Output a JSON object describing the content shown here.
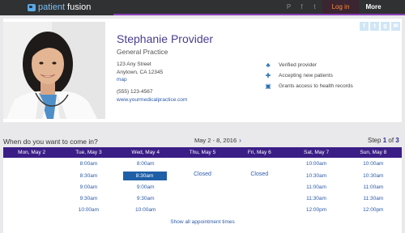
{
  "topbar": {
    "brand_part1": "patient",
    "brand_part2": "fusion",
    "social": [
      "P",
      "f",
      "t"
    ],
    "login_label": "Log in",
    "more_label": "More"
  },
  "share_icons": [
    "f",
    "t",
    "g",
    "✉"
  ],
  "provider": {
    "name": "Stephanie Provider",
    "specialty": "General Practice",
    "address_line1": "123 Any Street",
    "address_line2": "Anytown, CA 12345",
    "map_link": "map",
    "phone": "(555) 123-4567",
    "website": "www.yourmedicalpractice.com"
  },
  "features": [
    {
      "icon": "verified-provider-icon",
      "glyph": "♣",
      "label": "Verified provider"
    },
    {
      "icon": "new-patients-icon",
      "glyph": "✚",
      "label": "Accepting new patients"
    },
    {
      "icon": "health-records-icon",
      "glyph": "▣",
      "label": "Grants access to health records"
    }
  ],
  "booking": {
    "question": "When do you want to come in?",
    "date_range": "May 2 - 8, 2016",
    "next_arrow": "›",
    "step_prefix": "Step",
    "step_current": "1",
    "step_of": "of",
    "step_total": "3",
    "show_all": "Show all appointment times",
    "selected_color": "#1f5fa8",
    "header_color": "#3a1e86"
  },
  "days": [
    {
      "label": "Mon, May 2",
      "slots": [],
      "closed": ""
    },
    {
      "label": "Tue, May 3",
      "slots": [
        "8:00am",
        "8:30am",
        "9:00am",
        "9:30am",
        "10:00am"
      ],
      "closed": ""
    },
    {
      "label": "Wed, May 4",
      "slots": [
        "8:00am",
        "8:30am",
        "9:00am",
        "9:30am",
        "10:00am"
      ],
      "closed": "",
      "selected": 1
    },
    {
      "label": "Thu, May 5",
      "slots": [],
      "closed": "Closed"
    },
    {
      "label": "Fri, May 6",
      "slots": [],
      "closed": "Closed"
    },
    {
      "label": "Sat, May 7",
      "slots": [
        "10:00am",
        "10:30am",
        "11:00am",
        "11:30am",
        "12:00pm"
      ],
      "closed": ""
    },
    {
      "label": "Sun, May 8",
      "slots": [
        "10:00am",
        "10:30am",
        "11:00am",
        "11:30am",
        "12:00pm"
      ],
      "closed": ""
    }
  ]
}
